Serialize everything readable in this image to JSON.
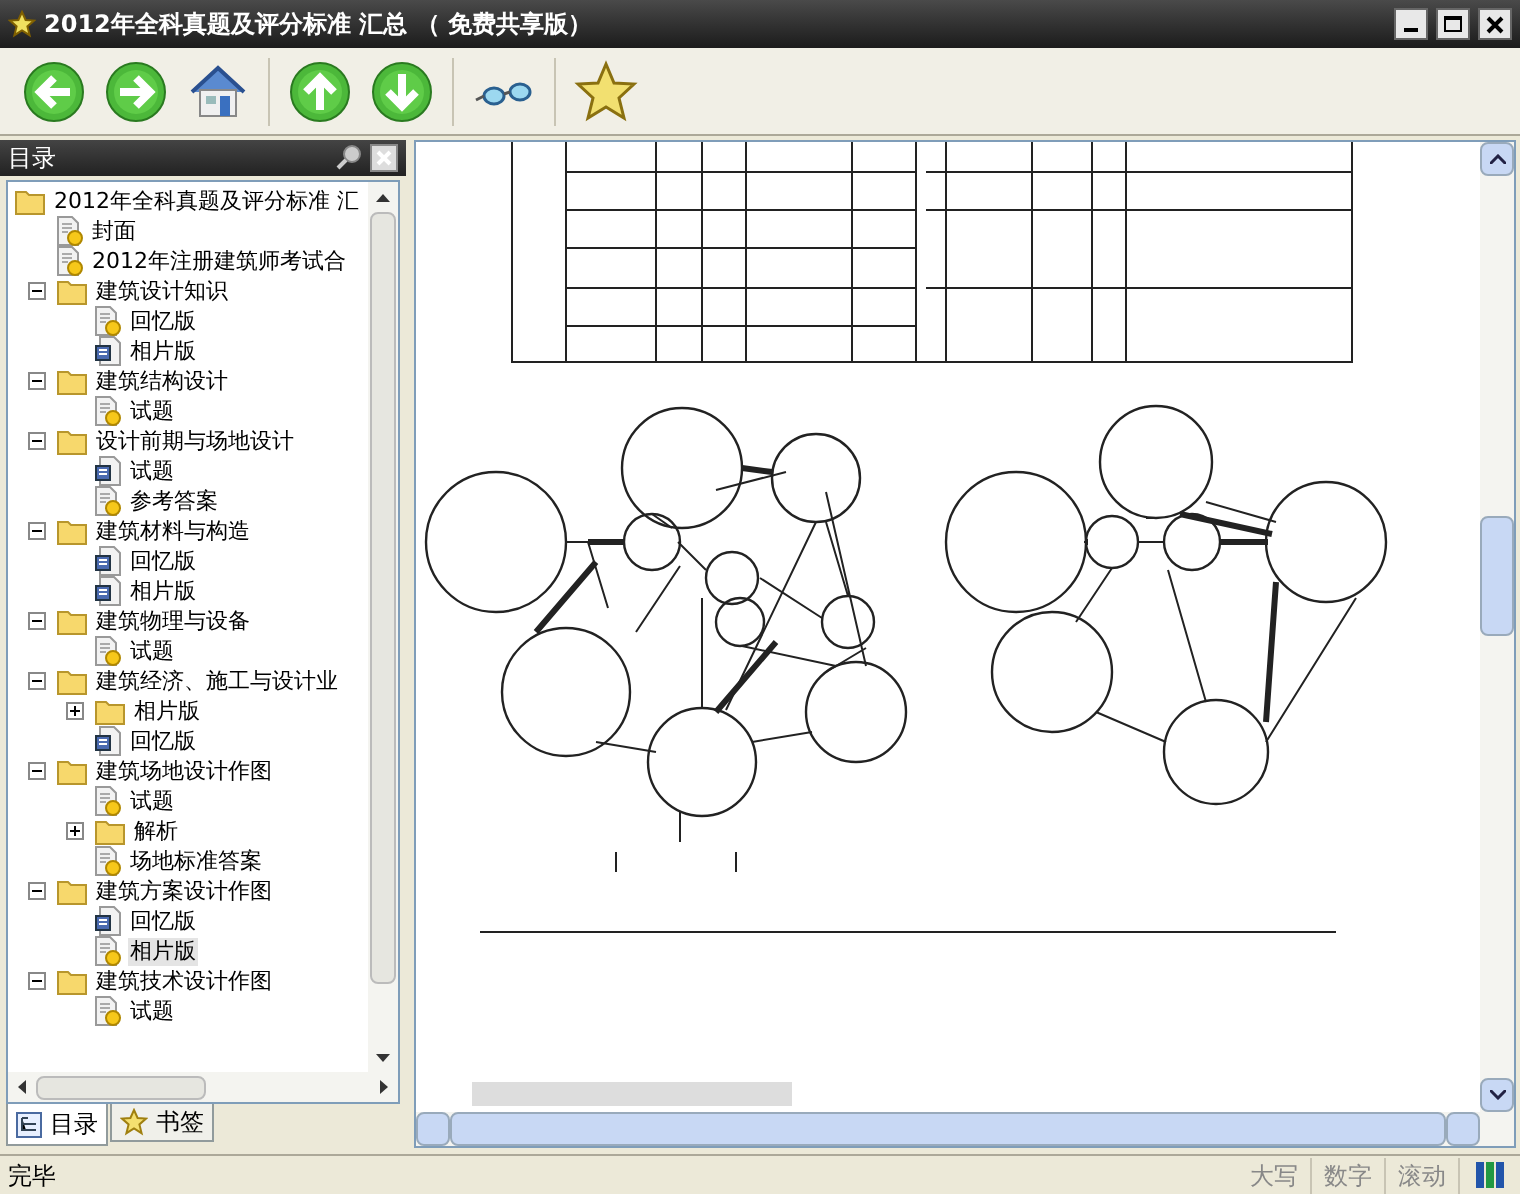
{
  "window": {
    "title": "2012年全科真题及评分标准 汇总 （ 免费共享版）"
  },
  "toolbar": [
    {
      "kind": "back"
    },
    {
      "kind": "forward"
    },
    {
      "kind": "home"
    },
    {
      "kind": "up"
    },
    {
      "kind": "down"
    },
    {
      "kind": "glasses"
    },
    {
      "kind": "star"
    }
  ],
  "sidebar": {
    "title": "目录",
    "tree": [
      {
        "label": "2012年全科真题及评分标准 汇",
        "kind": "folder",
        "selected": false,
        "children": [
          {
            "label": "封面",
            "kind": "page",
            "selected": false
          },
          {
            "label": "2012年注册建筑师考试合",
            "kind": "page",
            "selected": false
          },
          {
            "label": "建筑设计知识",
            "kind": "folder",
            "expanded": true,
            "selected": false,
            "children": [
              {
                "label": "回忆版",
                "kind": "page",
                "selected": false
              },
              {
                "label": "相片版",
                "kind": "doc",
                "selected": false
              }
            ]
          },
          {
            "label": "建筑结构设计",
            "kind": "folder",
            "expanded": true,
            "selected": false,
            "children": [
              {
                "label": "试题",
                "kind": "page",
                "selected": false
              }
            ]
          },
          {
            "label": "设计前期与场地设计",
            "kind": "folder",
            "expanded": true,
            "selected": false,
            "children": [
              {
                "label": "试题",
                "kind": "doc",
                "selected": false
              },
              {
                "label": "参考答案",
                "kind": "page",
                "selected": false
              }
            ]
          },
          {
            "label": "建筑材料与构造",
            "kind": "folder",
            "expanded": true,
            "selected": false,
            "children": [
              {
                "label": "回忆版",
                "kind": "doc",
                "selected": false
              },
              {
                "label": "相片版",
                "kind": "doc",
                "selected": false
              }
            ]
          },
          {
            "label": "建筑物理与设备",
            "kind": "folder",
            "expanded": true,
            "selected": false,
            "children": [
              {
                "label": "试题",
                "kind": "page",
                "selected": false
              }
            ]
          },
          {
            "label": "建筑经济、施工与设计业",
            "kind": "folder",
            "expanded": true,
            "selected": false,
            "children": [
              {
                "label": "相片版",
                "kind": "folder",
                "expanded": false,
                "selected": false
              },
              {
                "label": "回忆版",
                "kind": "doc",
                "selected": false
              }
            ]
          },
          {
            "label": "建筑场地设计作图",
            "kind": "folder",
            "expanded": true,
            "selected": false,
            "children": [
              {
                "label": "试题",
                "kind": "page",
                "selected": false
              },
              {
                "label": "解析",
                "kind": "folder",
                "expanded": false,
                "selected": false
              },
              {
                "label": "场地标准答案",
                "kind": "page",
                "selected": false
              }
            ]
          },
          {
            "label": "建筑方案设计作图",
            "kind": "folder",
            "expanded": true,
            "selected": false,
            "children": [
              {
                "label": "回忆版",
                "kind": "doc",
                "selected": false
              },
              {
                "label": "相片版",
                "kind": "page",
                "selected": true
              }
            ]
          },
          {
            "label": "建筑技术设计作图",
            "kind": "folder",
            "expanded": true,
            "selected": false,
            "children": [
              {
                "label": "试题",
                "kind": "page",
                "selected": false
              }
            ]
          }
        ]
      }
    ],
    "tabs": [
      {
        "label": "目录",
        "kind": "contents",
        "selected": true
      },
      {
        "label": "书签",
        "kind": "bookmarks",
        "selected": false
      }
    ]
  },
  "status_bar": {
    "text": "完毕",
    "indicators": [
      "大写",
      "数字",
      "滚动"
    ]
  }
}
